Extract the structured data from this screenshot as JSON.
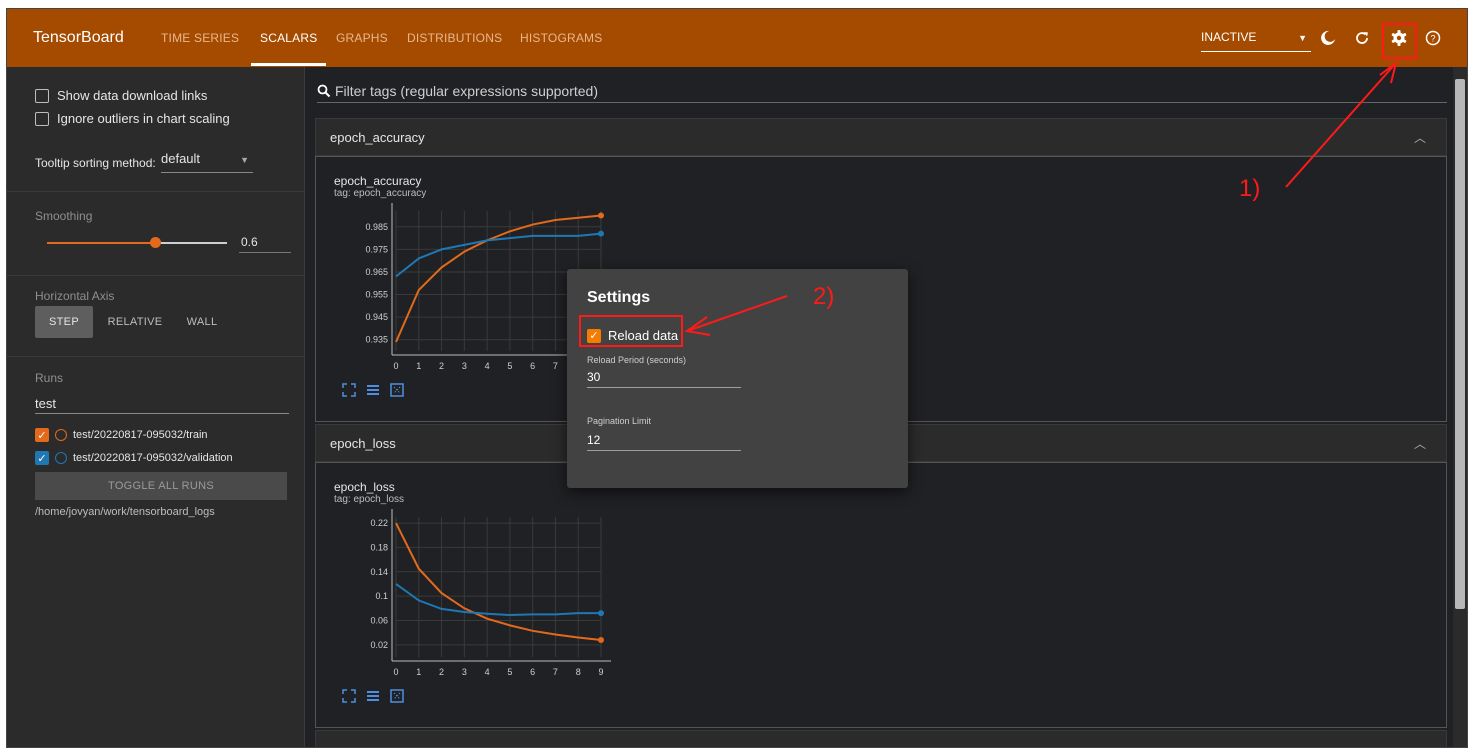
{
  "app": {
    "brand": "TensorBoard",
    "tabs": [
      {
        "label": "TIME SERIES",
        "active": false
      },
      {
        "label": "SCALARS",
        "active": true
      },
      {
        "label": "GRAPHS",
        "active": false
      },
      {
        "label": "DISTRIBUTIONS",
        "active": false
      },
      {
        "label": "HISTOGRAMS",
        "active": false
      }
    ],
    "status_select": "INACTIVE",
    "icons": [
      "dark-mode-icon",
      "reload-icon",
      "settings-icon",
      "help-icon"
    ],
    "colors": {
      "topbar": "#a54b00",
      "accent": "#e36a1c",
      "train": "#e36a1c",
      "validation": "#1f77b4"
    }
  },
  "sidebar": {
    "show_download_links": "Show data download links",
    "ignore_outliers": "Ignore outliers in chart scaling",
    "tooltip_label": "Tooltip sorting method:",
    "tooltip_value": "default",
    "smoothing_label": "Smoothing",
    "smoothing_value": "0.6",
    "smoothing_fraction": 0.6,
    "horizontal_axis_label": "Horizontal Axis",
    "axis_options": [
      "STEP",
      "RELATIVE",
      "WALL"
    ],
    "axis_selected": "STEP",
    "runs_label": "Runs",
    "runs_filter": "test",
    "runs": [
      {
        "name": "test/20220817-095032/train",
        "checked": true,
        "color": "#e36a1c"
      },
      {
        "name": "test/20220817-095032/validation",
        "checked": true,
        "color": "#1f77b4"
      }
    ],
    "toggle_all": "TOGGLE ALL RUNS",
    "logdir": "/home/jovyan/work/tensorboard_logs"
  },
  "main": {
    "filter_placeholder": "Filter tags (regular expressions supported)",
    "groups": [
      {
        "name": "epoch_accuracy",
        "card_title": "epoch_accuracy",
        "card_tag": "tag: epoch_accuracy"
      },
      {
        "name": "epoch_loss",
        "card_title": "epoch_loss",
        "card_tag": "tag: epoch_loss"
      }
    ]
  },
  "settings": {
    "title": "Settings",
    "reload_label": "Reload data",
    "reload_checked": true,
    "reload_period_label": "Reload Period (seconds)",
    "reload_period_value": "30",
    "pagination_label": "Pagination Limit",
    "pagination_value": "12"
  },
  "annotations": {
    "one": "1)",
    "two": "2)"
  },
  "chart_data": [
    {
      "type": "line",
      "title": "epoch_accuracy",
      "x": [
        0,
        1,
        2,
        3,
        4,
        5,
        6,
        7,
        8,
        9
      ],
      "x_ticks": [
        "0",
        "1",
        "2",
        "3",
        "4",
        "5",
        "6",
        "7"
      ],
      "y_ticks": [
        "0.985",
        "0.975",
        "0.965",
        "0.955",
        "0.945",
        "0.935"
      ],
      "ylim": [
        0.93,
        0.992
      ],
      "series": [
        {
          "name": "test/20220817-095032/train",
          "values": [
            0.934,
            0.957,
            0.967,
            0.974,
            0.979,
            0.983,
            0.986,
            0.988,
            0.989,
            0.99
          ]
        },
        {
          "name": "test/20220817-095032/validation",
          "values": [
            0.963,
            0.971,
            0.975,
            0.977,
            0.979,
            0.98,
            0.981,
            0.981,
            0.981,
            0.982
          ]
        }
      ]
    },
    {
      "type": "line",
      "title": "epoch_loss",
      "x": [
        0,
        1,
        2,
        3,
        4,
        5,
        6,
        7,
        8,
        9
      ],
      "x_ticks": [
        "0",
        "1",
        "2",
        "3",
        "4",
        "5",
        "6",
        "7",
        "8",
        "9"
      ],
      "y_ticks": [
        "0.22",
        "0.18",
        "0.14",
        "0.1",
        "0.06",
        "0.02"
      ],
      "ylim": [
        0.0,
        0.23
      ],
      "series": [
        {
          "name": "test/20220817-095032/train",
          "values": [
            0.22,
            0.145,
            0.105,
            0.08,
            0.063,
            0.052,
            0.043,
            0.037,
            0.032,
            0.028
          ]
        },
        {
          "name": "test/20220817-095032/validation",
          "values": [
            0.12,
            0.093,
            0.079,
            0.074,
            0.071,
            0.069,
            0.07,
            0.07,
            0.072,
            0.072
          ]
        }
      ]
    }
  ]
}
